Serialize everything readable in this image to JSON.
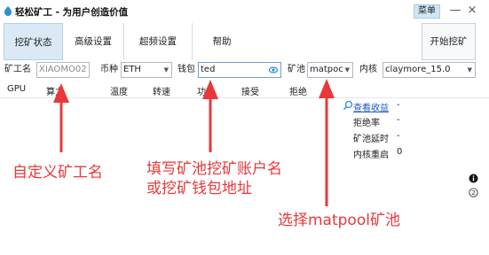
{
  "window": {
    "title": "轻松矿工 - 为用户创造价值",
    "menu_label": "菜单",
    "minimize_glyph": "—",
    "close_glyph": "×"
  },
  "tabs": [
    {
      "label": "挖矿状态",
      "active": true
    },
    {
      "label": "高级设置",
      "active": false
    },
    {
      "label": "超频设置",
      "active": false
    },
    {
      "label": "帮助",
      "active": false
    }
  ],
  "start_button": {
    "label": "开始挖矿"
  },
  "settings": {
    "worker_label": "矿工名",
    "worker_value": "XIAOMO02",
    "coin_label": "币种",
    "coin_value": "ETH",
    "wallet_label": "钱包",
    "wallet_value": "ted",
    "pool_label": "矿池",
    "pool_value": "matpoc",
    "kernel_label": "内核",
    "kernel_value": "claymore_15.0"
  },
  "table": {
    "columns": [
      "GPU",
      "算力",
      "温度",
      "转速",
      "功耗",
      "接受",
      "拒绝"
    ]
  },
  "stats": {
    "link_label": "查看收益",
    "link_value": "-",
    "rows": [
      {
        "label": "拒绝率",
        "value": "-"
      },
      {
        "label": "矿池延时",
        "value": "-"
      },
      {
        "label": "内核重启",
        "value": "0"
      }
    ]
  },
  "annotations": {
    "worker_note": "自定义矿工名",
    "wallet_note_line1": "填写矿池挖矿账户名",
    "wallet_note_line2": "或挖矿钱包地址",
    "pool_note": "选择matpool矿池",
    "color": "#e8383a"
  },
  "icons": {
    "app": "app-logo-icon",
    "eye": "eye-icon",
    "search": "search-icon",
    "info": "info-icon",
    "help": "help-icon"
  }
}
